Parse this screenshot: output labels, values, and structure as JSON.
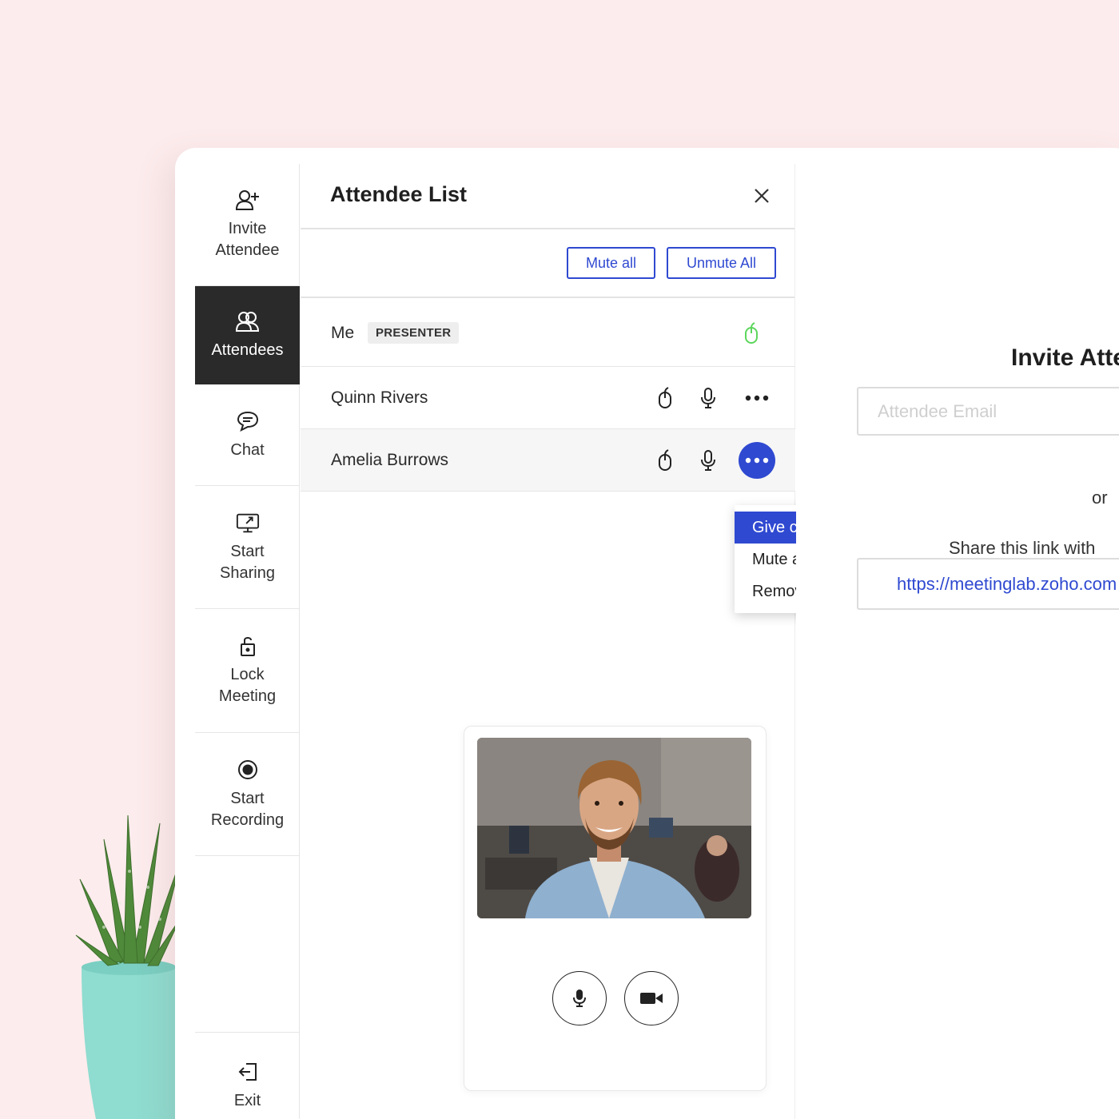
{
  "sidebar": {
    "items": [
      {
        "key": "invite",
        "label": "Invite\nAttendee",
        "icon": "add-person-icon"
      },
      {
        "key": "attendees",
        "label": "Attendees",
        "icon": "people-icon",
        "active": true
      },
      {
        "key": "chat",
        "label": "Chat",
        "icon": "chat-bubble-icon"
      },
      {
        "key": "share",
        "label": "Start\nSharing",
        "icon": "screen-share-icon"
      },
      {
        "key": "lock",
        "label": "Lock\nMeeting",
        "icon": "lock-icon"
      },
      {
        "key": "record",
        "label": "Start\nRecording",
        "icon": "record-icon"
      },
      {
        "key": "exit",
        "label": "Exit",
        "icon": "exit-icon"
      }
    ]
  },
  "panel": {
    "title": "Attendee List",
    "mute_all": "Mute all",
    "unmute_all": "Unmute All",
    "attendees": [
      {
        "name": "Me",
        "badge": "PRESENTER"
      },
      {
        "name": "Quinn Rivers"
      },
      {
        "name": "Amelia Burrows"
      }
    ],
    "menu": [
      "Give control",
      "Mute audio",
      "Remove"
    ]
  },
  "invite": {
    "title": "Invite Attendees",
    "email_placeholder": "Attendee Email",
    "or": "or",
    "share_text": "Share this link with",
    "link": "https://meetinglab.zoho.com"
  },
  "colors": {
    "accent": "#2f49d1",
    "control_green": "#5cd65c",
    "sidebar_active": "#2a2a2a",
    "background": "#fdeced"
  }
}
